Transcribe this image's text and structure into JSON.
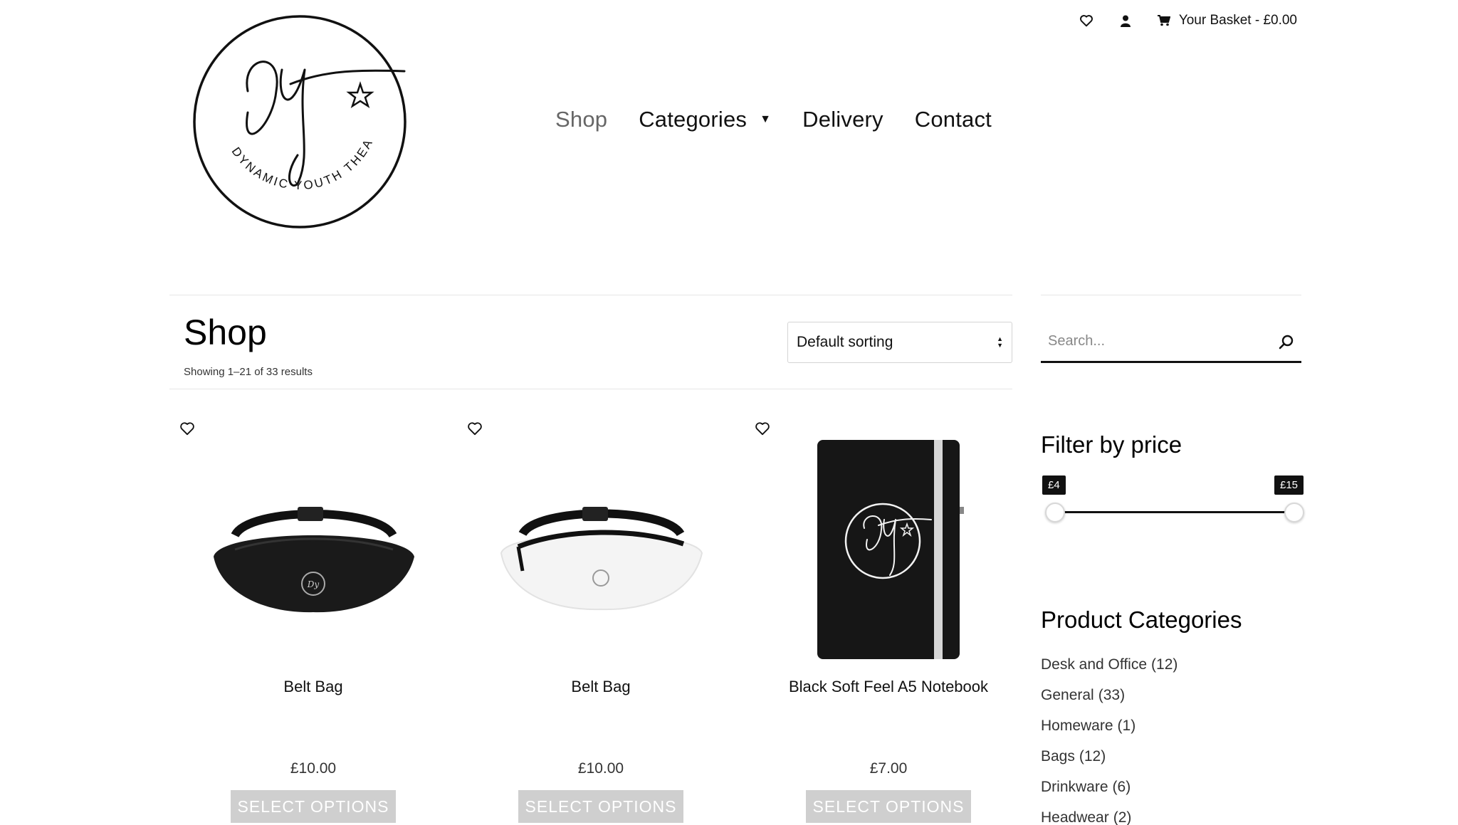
{
  "header": {
    "logo_text": "DYNAMIC YOUTH THEATRE",
    "basket_label": "Your Basket - £0.00",
    "icons": [
      "heart-icon",
      "user-icon",
      "cart-icon"
    ]
  },
  "nav": {
    "items": [
      {
        "label": "Shop",
        "active": true
      },
      {
        "label": "Categories",
        "has_dropdown": true
      },
      {
        "label": "Delivery"
      },
      {
        "label": "Contact"
      }
    ]
  },
  "shop": {
    "title": "Shop",
    "result_count": "Showing 1–21 of 33 results",
    "sorting": "Default sorting"
  },
  "products": [
    {
      "name": "Belt Bag",
      "price": "£10.00",
      "button": "SELECT OPTIONS",
      "variant": "black"
    },
    {
      "name": "Belt Bag",
      "price": "£10.00",
      "button": "SELECT OPTIONS",
      "variant": "white"
    },
    {
      "name": "Black Soft Feel A5 Notebook",
      "price": "£7.00",
      "button": "SELECT OPTIONS",
      "variant": "notebook"
    }
  ],
  "sidebar": {
    "search_placeholder": "Search...",
    "filter_title": "Filter by price",
    "price_min": "£4",
    "price_max": "£15",
    "categories_title": "Product Categories",
    "categories": [
      {
        "name": "Desk and Office",
        "count": "(12)"
      },
      {
        "name": "General",
        "count": "(33)"
      },
      {
        "name": "Homeware",
        "count": "(1)"
      },
      {
        "name": "Bags",
        "count": "(12)"
      },
      {
        "name": "Drinkware",
        "count": "(6)"
      },
      {
        "name": "Headwear",
        "count": "(2)"
      }
    ]
  },
  "colors": {
    "text": "#111111",
    "muted_nav": "#666666",
    "button_bg": "#cfcfcf",
    "tag_bg": "#111111"
  }
}
